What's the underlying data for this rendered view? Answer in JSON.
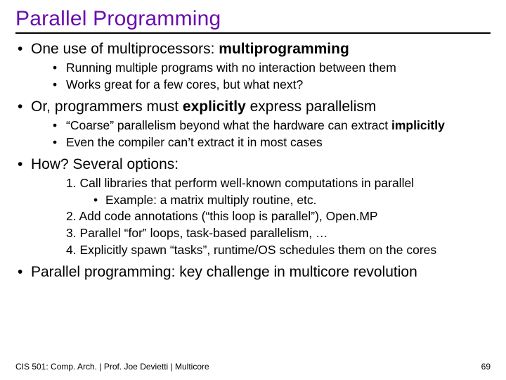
{
  "title": "Parallel Programming",
  "b1": {
    "pre": "One use of multiprocessors: ",
    "bold": "multiprogramming",
    "sub1": "Running multiple programs with no interaction between them",
    "sub2": "Works great for a few cores, but what next?"
  },
  "b2": {
    "pre": "Or, programmers must ",
    "bold": "explicitly",
    "post": " express parallelism",
    "sub1_pre": "“Coarse” parallelism beyond what the hardware can extract ",
    "sub1_bold": "implicitly",
    "sub2": "Even the compiler can’t extract it in most cases"
  },
  "b3": {
    "text": "How? Several options:",
    "o1": "1. Call libraries that perform well-known computations in parallel",
    "o1_sub": "Example: a matrix multiply routine, etc.",
    "o2": "2. Add code annotations (“this loop is parallel”), Open.MP",
    "o3": "3. Parallel “for” loops, task-based parallelism, …",
    "o4": "4. Explicitly spawn “tasks”, runtime/OS schedules them on the cores"
  },
  "b4": "Parallel programming: key challenge in multicore revolution",
  "footer_left": "CIS 501: Comp. Arch.  |  Prof. Joe Devietti  |  Multicore",
  "footer_right": "69"
}
